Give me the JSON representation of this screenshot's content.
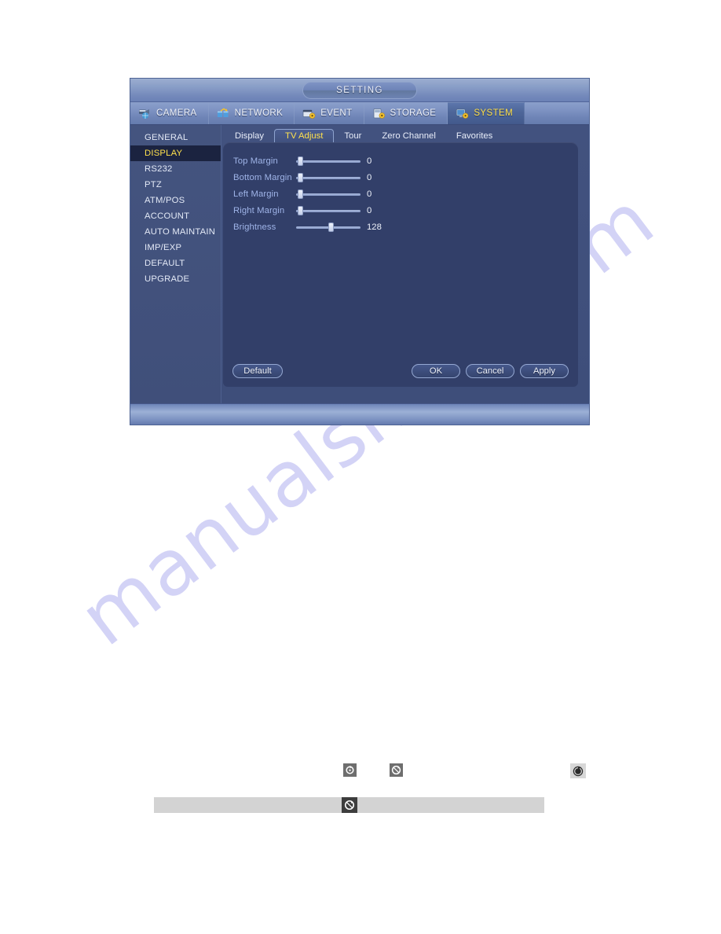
{
  "window": {
    "title": "SETTING"
  },
  "main_tabs": [
    {
      "label": "CAMERA",
      "icon": "camera-icon",
      "active": false
    },
    {
      "label": "NETWORK",
      "icon": "network-icon",
      "active": false
    },
    {
      "label": "EVENT",
      "icon": "event-icon",
      "active": false
    },
    {
      "label": "STORAGE",
      "icon": "storage-icon",
      "active": false
    },
    {
      "label": "SYSTEM",
      "icon": "system-icon",
      "active": true
    }
  ],
  "sidebar": {
    "items": [
      {
        "label": "GENERAL",
        "active": false
      },
      {
        "label": "DISPLAY",
        "active": true
      },
      {
        "label": "RS232",
        "active": false
      },
      {
        "label": "PTZ",
        "active": false
      },
      {
        "label": "ATM/POS",
        "active": false
      },
      {
        "label": "ACCOUNT",
        "active": false
      },
      {
        "label": "AUTO MAINTAIN",
        "active": false
      },
      {
        "label": "IMP/EXP",
        "active": false
      },
      {
        "label": "DEFAULT",
        "active": false
      },
      {
        "label": "UPGRADE",
        "active": false
      }
    ]
  },
  "sub_tabs": [
    {
      "label": "Display",
      "active": false
    },
    {
      "label": "TV Adjust",
      "active": true
    },
    {
      "label": "Tour",
      "active": false
    },
    {
      "label": "Zero Channel",
      "active": false
    },
    {
      "label": "Favorites",
      "active": false
    }
  ],
  "settings": {
    "rows": [
      {
        "label": "Top Margin",
        "value": "0",
        "percent": 2
      },
      {
        "label": "Bottom Margin",
        "value": "0",
        "percent": 2
      },
      {
        "label": "Left Margin",
        "value": "0",
        "percent": 2
      },
      {
        "label": "Right Margin",
        "value": "0",
        "percent": 2
      },
      {
        "label": "Brightness",
        "value": "128",
        "percent": 50
      }
    ]
  },
  "buttons": {
    "default_label": "Default",
    "ok_label": "OK",
    "cancel_label": "Cancel",
    "apply_label": "Apply"
  },
  "bottom_icons": [
    {
      "name": "rotate-icon-solid",
      "style": "dark"
    },
    {
      "name": "rotate-icon-outline",
      "style": "dark"
    },
    {
      "name": "rotate-icon-solid-2",
      "style": "light"
    }
  ],
  "bottom_bar": {
    "icon": "rotate-icon-bar"
  },
  "watermark": {
    "text": "manualshive.com"
  },
  "colors": {
    "accent_yellow": "#ffe14d",
    "panel_navy": "#323f69",
    "window_navy": "#3e4e7a",
    "titlebar_blue": "#879cc6",
    "label_blue": "#9fb4e8",
    "sidebar_active_bg": "#1b2340"
  }
}
